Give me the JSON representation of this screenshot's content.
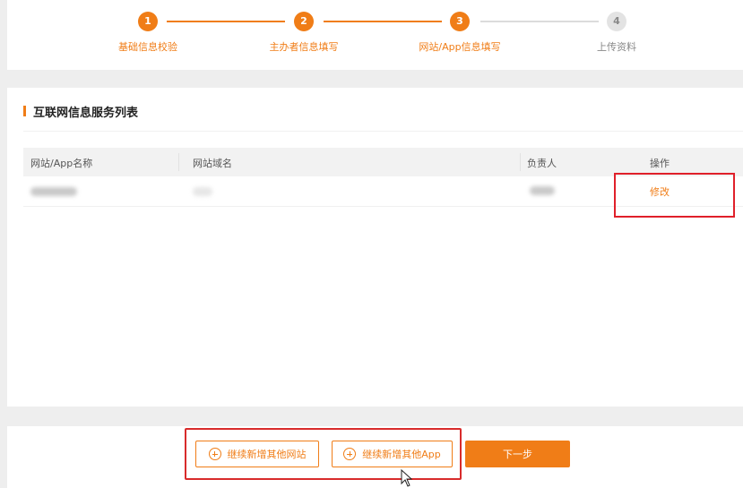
{
  "stepper": {
    "steps": [
      {
        "number": "1",
        "label": "基础信息校验",
        "state": "done"
      },
      {
        "number": "2",
        "label": "主办者信息填写",
        "state": "done"
      },
      {
        "number": "3",
        "label": "网站/App信息填写",
        "state": "current"
      },
      {
        "number": "4",
        "label": "上传资料",
        "state": "pending"
      }
    ]
  },
  "section": {
    "title": "互联网信息服务列表"
  },
  "table": {
    "headers": [
      "网站/App名称",
      "网站域名",
      "负责人",
      "操作"
    ],
    "rows": [
      {
        "name": "",
        "domain": "",
        "owner": "",
        "action": "修改"
      }
    ]
  },
  "footer": {
    "add_website_label": "继续新增其他网站",
    "add_app_label": "继续新增其他App",
    "next_label": "下一步"
  },
  "colors": {
    "accent": "#f07d17",
    "highlight": "#e0202a",
    "inactive": "#dcdcdc"
  },
  "icons": [
    "plus-circle-icon",
    "mouse-pointer-icon"
  ]
}
